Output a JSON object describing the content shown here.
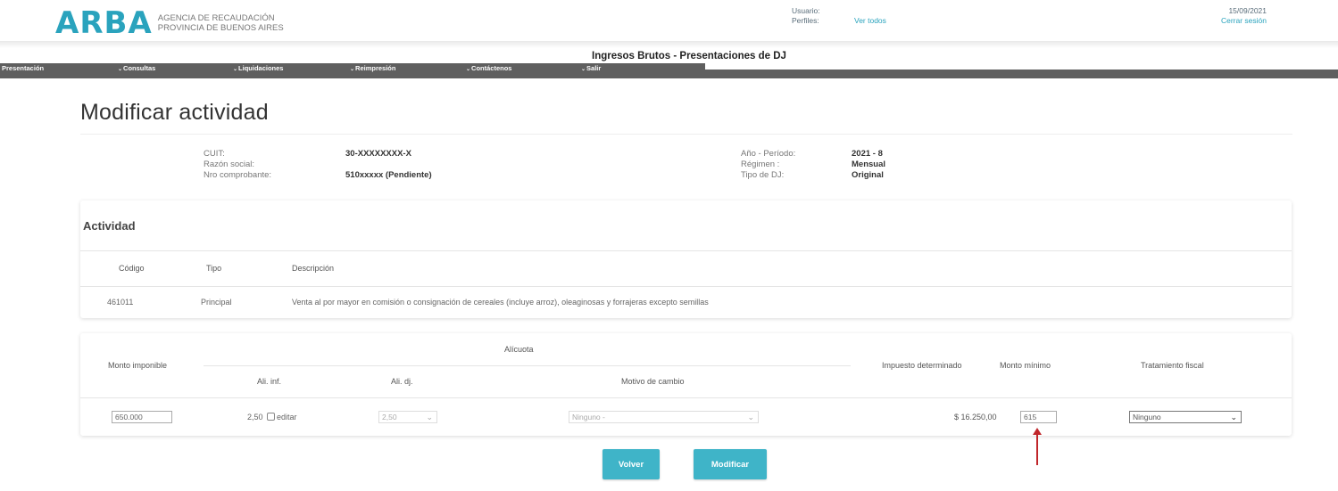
{
  "header": {
    "logo": "ARBA",
    "logo_sub_line1": "AGENCIA DE RECAUDACIÓN",
    "logo_sub_line2": "PROVINCIA DE BUENOS AIRES",
    "usuario_label": "Usuario:",
    "perfiles_label": "Perfiles:",
    "ver_todos": "Ver todos",
    "date": "15/09/2021",
    "cerrar_sesion": "Cerrar sesión"
  },
  "app_title": "Ingresos Brutos - Presentaciones de DJ",
  "menu": {
    "items": [
      {
        "label": "Presentación",
        "arrow": false
      },
      {
        "label": "Consultas",
        "arrow": true
      },
      {
        "label": "Liquidaciones",
        "arrow": true
      },
      {
        "label": "Reimpresión",
        "arrow": true
      },
      {
        "label": "Contáctenos",
        "arrow": true
      },
      {
        "label": "Salir",
        "arrow": true
      }
    ]
  },
  "page_title": "Modificar actividad",
  "info": {
    "cuit_label": "CUIT:",
    "cuit_value": "30-XXXXXXXX-X",
    "razon_label": "Razón social:",
    "razon_value": "",
    "comprobante_label": "Nro comprobante:",
    "comprobante_value": "510xxxxx (Pendiente)",
    "anio_label": "Año - Período:",
    "anio_value": "2021 - 8",
    "regimen_label": "Régimen :",
    "regimen_value": "Mensual",
    "tipo_dj_label": "Tipo de DJ:",
    "tipo_dj_value": "Original"
  },
  "actividad": {
    "title": "Actividad",
    "headers": [
      "Código",
      "Tipo",
      "Descripción"
    ],
    "row": {
      "codigo": "461011",
      "tipo": "Principal",
      "descripcion": "Venta al por mayor en comisión o consignación de cereales (incluye arroz), oleaginosas y forrajeras excepto semillas"
    }
  },
  "liquidacion": {
    "monto_imponible_label": "Monto imponible",
    "alicuota_label": "Alícuota",
    "ali_inf_label": "Ali. inf.",
    "ali_dj_label": "Ali. dj.",
    "motivo_label": "Motivo de cambio",
    "impuesto_label": "Impuesto determinado",
    "monto_minimo_label": "Monto mínimo",
    "tratamiento_label": "Tratamiento fiscal",
    "monto_imponible_value": "650.000",
    "ali_inf_value": "2,50",
    "editar_label": "editar",
    "ali_dj_value": "2,50",
    "motivo_value": "Ninguno -",
    "impuesto_value": "$ 16.250,00",
    "monto_minimo_value": "615",
    "tratamiento_value": "Ninguno"
  },
  "buttons": {
    "volver": "Volver",
    "modificar": "Modificar"
  },
  "colors": {
    "brand": "#2aa3bd",
    "button": "#3fb4c8",
    "menubar": "#5f5f5f",
    "annotation_arrow": "#c0262b"
  }
}
